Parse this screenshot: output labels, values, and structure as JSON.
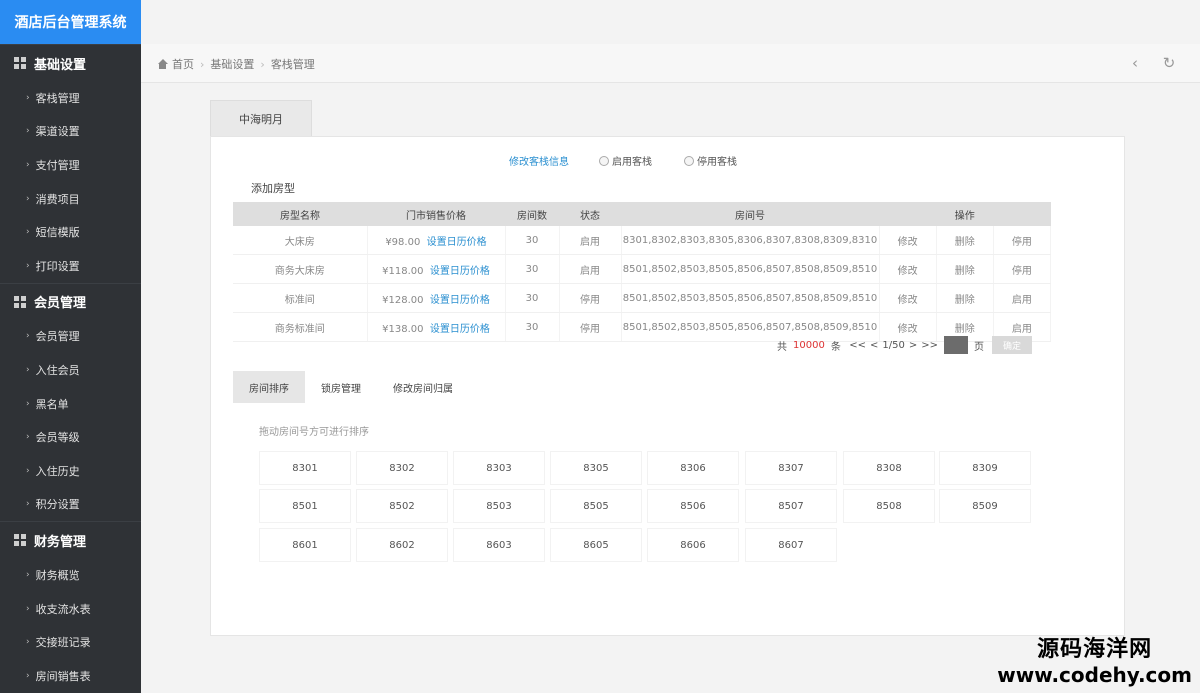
{
  "app_title": "酒店后台管理系统",
  "sidebar": {
    "groups": [
      {
        "label": "基础设置",
        "items": [
          "客栈管理",
          "渠道设置",
          "支付管理",
          "消费项目",
          "短信模版",
          "打印设置"
        ]
      },
      {
        "label": "会员管理",
        "items": [
          "会员管理",
          "入住会员",
          "黑名单",
          "会员等级",
          "入住历史",
          "积分设置"
        ]
      },
      {
        "label": "财务管理",
        "items": [
          "财务概览",
          "收支流水表",
          "交接班记录",
          "房间销售表"
        ]
      }
    ]
  },
  "breadcrumb": {
    "home": "首页",
    "level1": "基础设置",
    "level2": "客栈管理"
  },
  "topbar_icons": {
    "back": "chevron-left-icon",
    "refresh": "refresh-icon"
  },
  "hotel_tab": "中海明月",
  "status_bar": {
    "edit_link": "修改客栈信息",
    "enable": "启用客栈",
    "disable": "停用客栈"
  },
  "add_room_type": "添加房型",
  "table": {
    "headers": [
      "房型名称",
      "门市销售价格",
      "房间数",
      "状态",
      "房间号",
      "操作"
    ],
    "rows": [
      {
        "name": "大床房",
        "price": "¥98.00",
        "price_link": "设置日历价格",
        "count": "30",
        "status": "启用",
        "rooms": "8301,8302,8303,8305,8306,8307,8308,8309,8310",
        "op1": "修改",
        "op2": "删除",
        "op3": "停用"
      },
      {
        "name": "商务大床房",
        "price": "¥118.00",
        "price_link": "设置日历价格",
        "count": "30",
        "status": "启用",
        "rooms": "8501,8502,8503,8505,8506,8507,8508,8509,8510",
        "op1": "修改",
        "op2": "删除",
        "op3": "停用"
      },
      {
        "name": "标准间",
        "price": "¥128.00",
        "price_link": "设置日历价格",
        "count": "30",
        "status": "停用",
        "rooms": "8501,8502,8503,8505,8506,8507,8508,8509,8510",
        "op1": "修改",
        "op2": "删除",
        "op3": "启用"
      },
      {
        "name": "商务标准间",
        "price": "¥138.00",
        "price_link": "设置日历价格",
        "count": "30",
        "status": "停用",
        "rooms": "8501,8502,8503,8505,8506,8507,8508,8509,8510",
        "op1": "修改",
        "op2": "删除",
        "op3": "启用"
      }
    ]
  },
  "pager": {
    "prefix": "共",
    "total": "10000",
    "unit": "条",
    "first": "<<",
    "prev": "<",
    "page": "1/50",
    "next": ">",
    "last": ">>",
    "page_label": "页",
    "confirm": "确定"
  },
  "subtabs": [
    "房间排序",
    "锁房管理",
    "修改房间归属"
  ],
  "sort_hint": "拖动房间号方可进行排序",
  "room_grid": [
    [
      "8301",
      "8302",
      "8303",
      "8305",
      "8306",
      "8307",
      "8308",
      "8309"
    ],
    [
      "8501",
      "8502",
      "8503",
      "8505",
      "8506",
      "8507",
      "8508",
      "8509"
    ],
    [
      "8601",
      "8602",
      "8603",
      "8605",
      "8606",
      "8607"
    ]
  ],
  "watermark": {
    "line1": "源码海洋网",
    "line2": "www.codehy.com"
  }
}
